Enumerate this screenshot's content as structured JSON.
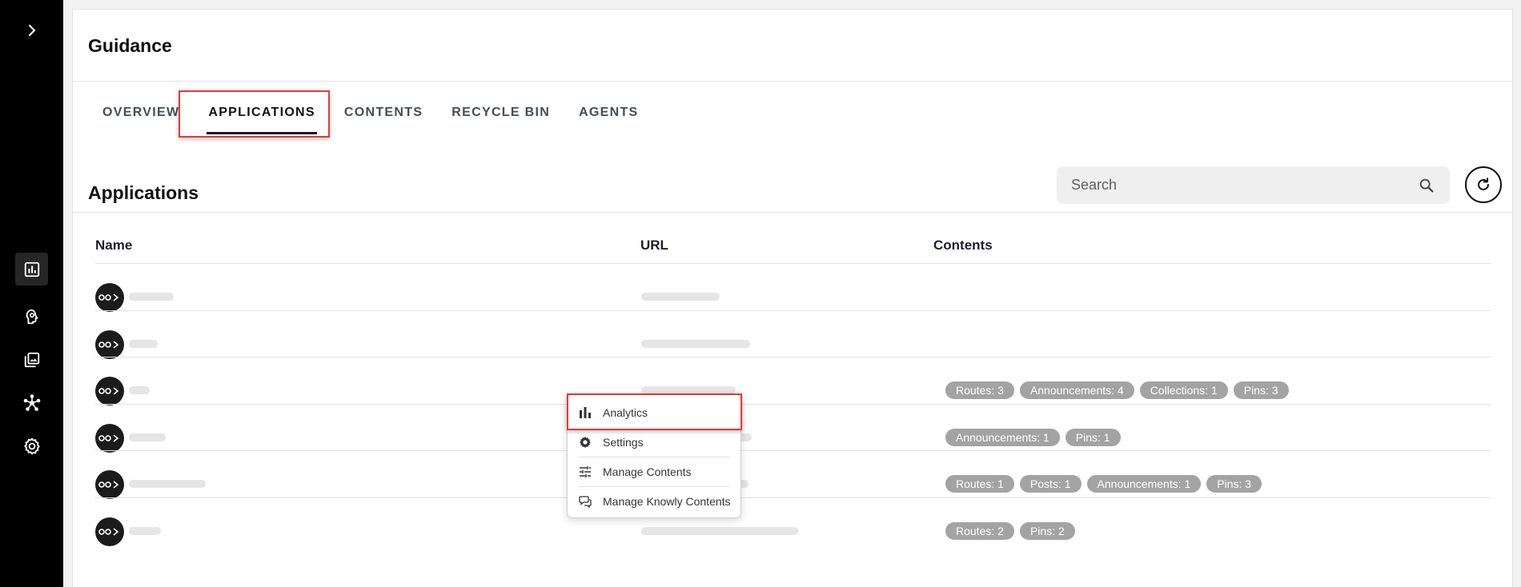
{
  "sidebar": {
    "expand_icon": "chevron-right-icon",
    "items": [
      {
        "name": "analytics",
        "icon": "bar-chart-box-icon",
        "active": true
      },
      {
        "name": "guidance",
        "icon": "head-lightbulb-icon",
        "active": false
      },
      {
        "name": "media",
        "icon": "image-stack-icon",
        "active": false
      },
      {
        "name": "integrations",
        "icon": "hub-network-icon",
        "active": false
      },
      {
        "name": "settings",
        "icon": "gear-icon",
        "active": false
      }
    ]
  },
  "page": {
    "title": "Guidance"
  },
  "tabs": [
    {
      "label": "OVERVIEW",
      "active": false
    },
    {
      "label": "APPLICATIONS",
      "active": true
    },
    {
      "label": "CONTENTS",
      "active": false
    },
    {
      "label": "RECYCLE BIN",
      "active": false
    },
    {
      "label": "AGENTS",
      "active": false
    }
  ],
  "section": {
    "title": "Applications"
  },
  "search": {
    "placeholder": "Search",
    "value": ""
  },
  "table": {
    "columns": [
      "Name",
      "URL",
      "Contents"
    ],
    "rows": [
      {
        "contents": []
      },
      {
        "contents": []
      },
      {
        "contents": [
          "Routes: 3",
          "Announcements: 4",
          "Collections: 1",
          "Pins: 3"
        ]
      },
      {
        "contents": [
          "Announcements: 1",
          "Pins: 1"
        ]
      },
      {
        "contents": [
          "Routes: 1",
          "Posts: 1",
          "Announcements: 1",
          "Pins: 3"
        ]
      },
      {
        "contents": [
          "Routes: 2",
          "Pins: 2"
        ]
      }
    ]
  },
  "context_menu": {
    "items": [
      {
        "label": "Analytics",
        "icon": "bar-chart-icon"
      },
      {
        "label": "Settings",
        "icon": "gear-icon"
      },
      {
        "label": "Manage Contents",
        "icon": "sliders-icon"
      },
      {
        "label": "Manage Knowly Contents",
        "icon": "chat-bubbles-icon"
      }
    ]
  },
  "colors": {
    "highlight": "#e53935",
    "chip_bg": "#a3a3a3",
    "rail_bg": "#000000"
  }
}
